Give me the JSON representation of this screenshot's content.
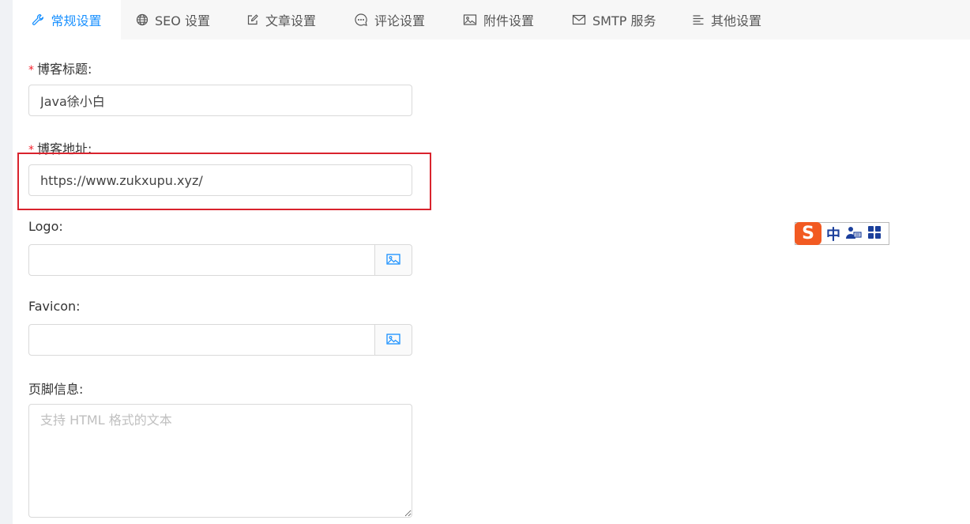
{
  "tabs": [
    {
      "label": "常规设置",
      "icon": "wrench-icon",
      "active": true
    },
    {
      "label": "SEO 设置",
      "icon": "globe-icon",
      "active": false
    },
    {
      "label": "文章设置",
      "icon": "edit-icon",
      "active": false
    },
    {
      "label": "评论设置",
      "icon": "comment-icon",
      "active": false
    },
    {
      "label": "附件设置",
      "icon": "picture-icon",
      "active": false
    },
    {
      "label": "SMTP 服务",
      "icon": "mail-icon",
      "active": false
    },
    {
      "label": "其他设置",
      "icon": "align-left-icon",
      "active": false
    }
  ],
  "form": {
    "blog_title": {
      "label": "博客标题:",
      "required_mark": "*",
      "value": "Java徐小白"
    },
    "blog_url": {
      "label": "博客地址:",
      "required_mark": "*",
      "value": "https://www.zukxupu.xyz/"
    },
    "logo": {
      "label": "Logo:",
      "value": ""
    },
    "favicon": {
      "label": "Favicon:",
      "value": ""
    },
    "footer": {
      "label": "页脚信息:",
      "placeholder": "支持 HTML 格式的文本"
    }
  },
  "ime": {
    "mode": "中"
  },
  "colors": {
    "accent": "#1890ff",
    "required": "#f5222d",
    "highlight": "#d9232d"
  }
}
